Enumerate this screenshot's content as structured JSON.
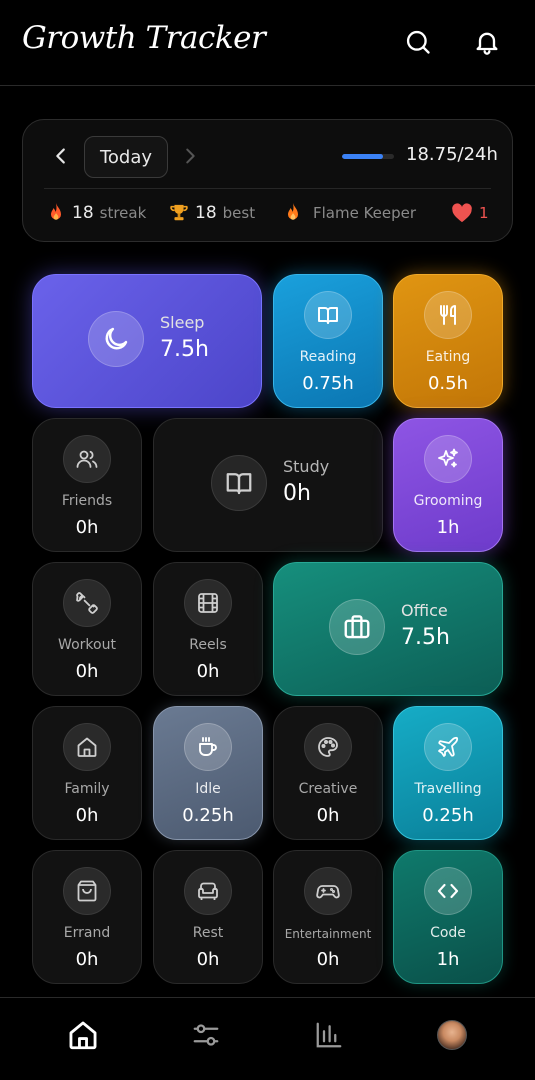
{
  "app": {
    "title": "Growth Tracker"
  },
  "header": {
    "icons": [
      "search-icon",
      "bell-icon"
    ]
  },
  "summary": {
    "day_label": "Today",
    "progress_fraction": 0.78,
    "progress_text": "18.75/24h",
    "streak": {
      "value": "18",
      "label": "streak"
    },
    "best": {
      "value": "18",
      "label": "best"
    },
    "title_badge": "Flame Keeper",
    "hearts": "1"
  },
  "tiles": {
    "sleep": {
      "label": "Sleep",
      "value": "7.5h"
    },
    "reading": {
      "label": "Reading",
      "value": "0.75h"
    },
    "eating": {
      "label": "Eating",
      "value": "0.5h"
    },
    "friends": {
      "label": "Friends",
      "value": "0h"
    },
    "study": {
      "label": "Study",
      "value": "0h"
    },
    "grooming": {
      "label": "Grooming",
      "value": "1h"
    },
    "workout": {
      "label": "Workout",
      "value": "0h"
    },
    "reels": {
      "label": "Reels",
      "value": "0h"
    },
    "office": {
      "label": "Office",
      "value": "7.5h"
    },
    "family": {
      "label": "Family",
      "value": "0h"
    },
    "idle": {
      "label": "Idle",
      "value": "0.25h"
    },
    "creative": {
      "label": "Creative",
      "value": "0h"
    },
    "travelling": {
      "label": "Travelling",
      "value": "0.25h"
    },
    "errand": {
      "label": "Errand",
      "value": "0h"
    },
    "rest": {
      "label": "Rest",
      "value": "0h"
    },
    "entertainment": {
      "label": "Entertainment",
      "value": "0h"
    },
    "code": {
      "label": "Code",
      "value": "1h"
    }
  },
  "bottom_nav": {
    "items": [
      "home-icon",
      "sliders-icon",
      "chart-icon",
      "avatar"
    ],
    "active": "home-icon"
  },
  "colors": {
    "progress": "#3b82f6",
    "flame": "#ff6a2a",
    "trophy": "#f0a020",
    "heart": "#ef5350"
  }
}
